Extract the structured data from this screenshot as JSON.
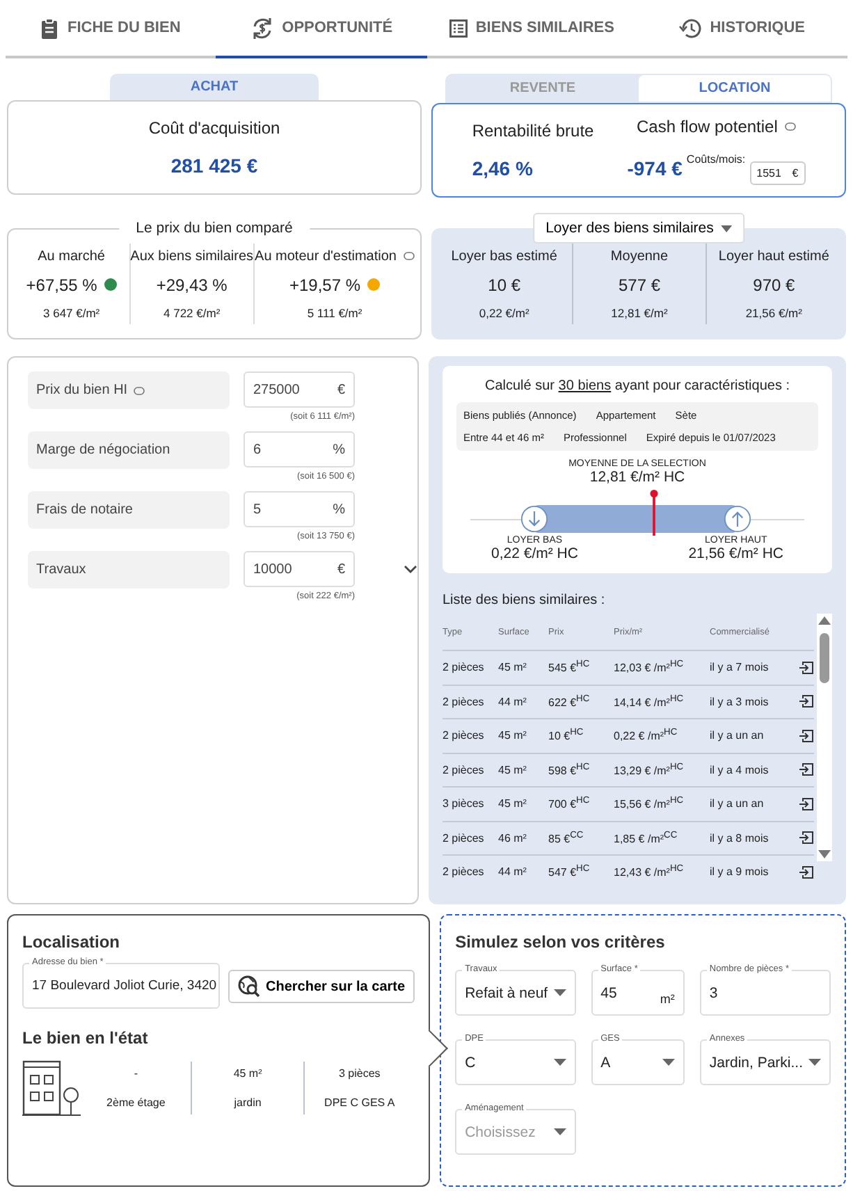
{
  "tabs": [
    {
      "label": "FICHE DU BIEN",
      "kind": "clipboard",
      "selected": false
    },
    {
      "label": "OPPORTUNITÉ",
      "kind": "exchange",
      "selected": true
    },
    {
      "label": "BIENS SIMILAIRES",
      "kind": "list",
      "selected": false
    },
    {
      "label": "HISTORIQUE",
      "kind": "history",
      "selected": false
    }
  ],
  "achat": {
    "tabs": [
      {
        "label": "ACHAT",
        "selected": true
      }
    ],
    "title": "Coût d'acquisition",
    "value": "281 425 €"
  },
  "resale": {
    "tabs": [
      {
        "label": "REVENTE",
        "selected": false
      },
      {
        "label": "LOCATION",
        "selected": true
      }
    ],
    "yield": {
      "label": "Rentabilité brute",
      "value": "2,46 %"
    },
    "cashflow": {
      "label": "Cash flow potentiel",
      "value": "-974 €",
      "costs_label": "Coûts/mois:",
      "costs_value": "1551",
      "unit": "€"
    }
  },
  "comparison": {
    "title": "Le prix du bien comparé",
    "items": [
      {
        "label": "Au marché",
        "info": false,
        "percent": "+67,55 %",
        "per_m2": "3 647 €/m²",
        "color": "#2e8b4e"
      },
      {
        "label": "Aux biens similaires",
        "info": false,
        "percent": "+29,43 %",
        "per_m2": "4 722 €/m²"
      },
      {
        "label": "Au moteur d'estimation",
        "info": true,
        "percent": "+19,57 %",
        "per_m2": "5 111 €/m²",
        "color": "#f5a700"
      }
    ]
  },
  "rent": {
    "dropdown": "Loyer des biens similaires",
    "items": [
      {
        "label": "Loyer bas estimé",
        "value": "10 €",
        "per_m2": "0,22 €/m²"
      },
      {
        "label": "Moyenne",
        "value": "577 €",
        "per_m2": "12,81 €/m²"
      },
      {
        "label": "Loyer haut estimé",
        "value": "970 €",
        "per_m2": "21,56 €/m²"
      }
    ]
  },
  "form": [
    {
      "label": "Prix du bien HI",
      "info": true,
      "value": "275000",
      "unit": "€",
      "note": "(soit 6 111 €/m²)",
      "expandable": false
    },
    {
      "label": "Marge de négociation",
      "info": false,
      "value": "6",
      "unit": "%",
      "note": "(soit 16 500 €)",
      "expandable": false
    },
    {
      "label": "Frais de notaire",
      "info": false,
      "value": "5",
      "unit": "%",
      "note": "(soit 13 750 €)",
      "expandable": false
    },
    {
      "label": "Travaux",
      "info": false,
      "value": "10000",
      "unit": "€",
      "note": "(soit 222 €/m²)",
      "expandable": true
    }
  ],
  "calc": {
    "prefix": "Calculé sur",
    "link": "30 biens",
    "suffix": "ayant pour caractéristiques :",
    "criteria": [
      [
        "Biens publiés (Annonce)",
        "Appartement",
        "Sète"
      ],
      [
        "Entre 44 et 46 m²",
        "Professionnel",
        "Expiré depuis le 01/07/2023"
      ]
    ],
    "mean_label": "MOYENNE DE LA SELECTION",
    "mean_value": "12,81 €/m² HC",
    "level": 0.55,
    "low_label": "LOYER BAS",
    "low_value": "0,22 €/m² HC",
    "high_label": "LOYER HAUT",
    "high_value": "21,56 €/m² HC"
  },
  "list": {
    "title": "Liste des biens similaires :",
    "columns": [
      "Type",
      "Surface",
      "Prix",
      "Prix/m²",
      "Commercialisé"
    ],
    "rows": [
      {
        "type": "2 pièces",
        "surface": "45 m²",
        "price": "545 €$^{HC}$",
        "price_m2": "12,03 € /m²$^{HC}$",
        "listed": "il y a 7 mois"
      },
      {
        "type": "2 pièces",
        "surface": "44 m²",
        "price": "622 €$^{HC}$",
        "price_m2": "14,14 € /m²$^{HC}$",
        "listed": "il y a 3 mois"
      },
      {
        "type": "2 pièces",
        "surface": "45 m²",
        "price": "10 €$^{HC}$",
        "price_m2": "0,22 € /m²$^{HC}$",
        "listed": "il y a un an"
      },
      {
        "type": "2 pièces",
        "surface": "45 m²",
        "price": "598 €$^{HC}$",
        "price_m2": "13,29 € /m²$^{HC}$",
        "listed": "il y a 4 mois"
      },
      {
        "type": "3 pièces",
        "surface": "45 m²",
        "price": "700 €$^{HC}$",
        "price_m2": "15,56 € /m²$^{HC}$",
        "listed": "il y a un an"
      },
      {
        "type": "2 pièces",
        "surface": "46 m²",
        "price": "85 €$^{CC}$",
        "price_m2": "1,85 € /m²$^{CC}$",
        "listed": "il y a 8 mois"
      },
      {
        "type": "2 pièces",
        "surface": "44 m²",
        "price": "547 €$^{HC}$",
        "price_m2": "12,43 € /m²$^{HC}$",
        "listed": "il y a 9 mois"
      }
    ]
  },
  "location": {
    "title": "Localisation",
    "address_label": "Adresse du bien *",
    "address_value": "17 Boulevard Joliot Curie, 3420",
    "map_button": "Chercher sur la carte",
    "state_title": "Le bien en l'état",
    "details": [
      [
        "-",
        "2ème étage"
      ],
      [
        "45 m²",
        "jardin"
      ],
      [
        "3 pièces",
        "DPE C  GES A"
      ]
    ]
  },
  "simulation": {
    "title": "Simulez selon vos critères",
    "fields": [
      {
        "label": "Travaux",
        "kind": "select",
        "value": "Refait à neuf"
      },
      {
        "label": "Surface *",
        "kind": "input",
        "value": "45",
        "unit": "m²"
      },
      {
        "label": "Nombre de pièces *",
        "kind": "input",
        "value": "3"
      },
      {
        "label": "DPE",
        "kind": "select",
        "value": "C"
      },
      {
        "label": "GES",
        "kind": "select",
        "value": "A"
      },
      {
        "label": "Annexes",
        "kind": "select",
        "value": "Jardin, Parki..."
      },
      {
        "label": "Aménagement",
        "kind": "select",
        "placeholder": "Choisissez"
      }
    ]
  }
}
